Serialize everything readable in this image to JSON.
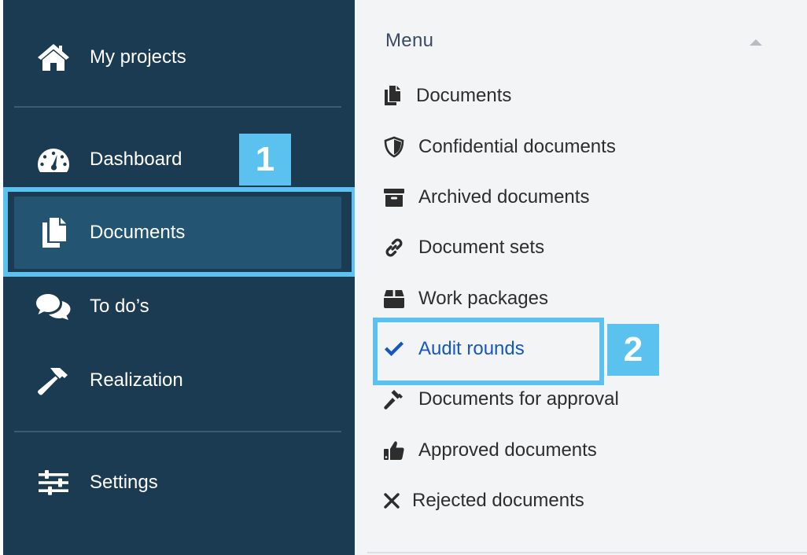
{
  "sidebar": {
    "items": [
      {
        "label": "My projects",
        "icon": "home-icon"
      },
      {
        "label": "Dashboard",
        "icon": "gauge-icon"
      },
      {
        "label": "Documents",
        "icon": "documents-icon",
        "active": true
      },
      {
        "label": "To do’s",
        "icon": "chat-bubbles-icon"
      },
      {
        "label": "Realization",
        "icon": "hammer-icon"
      },
      {
        "label": "Settings",
        "icon": "sliders-icon"
      }
    ]
  },
  "annotations": {
    "badge_1": "1",
    "badge_2": "2",
    "highlight_color": "#5bc2ef"
  },
  "menu": {
    "title": "Menu",
    "items": [
      {
        "label": "Documents",
        "icon": "files-icon"
      },
      {
        "label": "Confidential documents",
        "icon": "shield-icon"
      },
      {
        "label": "Archived documents",
        "icon": "archive-icon"
      },
      {
        "label": "Document sets",
        "icon": "link-icon"
      },
      {
        "label": "Work packages",
        "icon": "box-icon"
      },
      {
        "label": "Audit rounds",
        "icon": "check-icon",
        "selected": true
      },
      {
        "label": "Documents for approval",
        "icon": "gavel-icon"
      },
      {
        "label": "Approved documents",
        "icon": "thumbs-up-icon"
      },
      {
        "label": "Rejected documents",
        "icon": "x-icon"
      }
    ]
  },
  "colors": {
    "sidebar_bg": "#1b3b52",
    "active_bg": "#235572",
    "panel_bg": "#f3f4f6",
    "selected_text": "#1556c2"
  }
}
